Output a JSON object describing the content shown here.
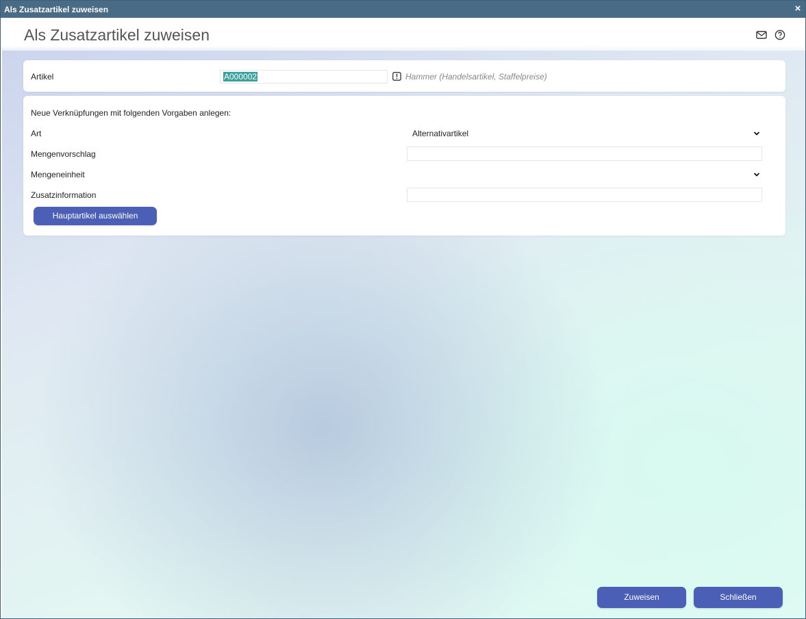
{
  "window": {
    "title": "Als Zusatzartikel zuweisen",
    "close_label": "×"
  },
  "header": {
    "title": "Als Zusatzartikel zuweisen",
    "icons": [
      "mail-icon",
      "help-icon"
    ]
  },
  "artikel": {
    "label": "Artikel",
    "value": "A000002",
    "description": "Hammer (Handelsartikel, Staffelpreise)",
    "icon": "warning-icon"
  },
  "vorgaben": {
    "heading": "Neue Verknüpfungen mit folgenden Vorgaben anlegen:",
    "art": {
      "label": "Art",
      "value": "Alternativartikel"
    },
    "mengenvorschlag": {
      "label": "Mengenvorschlag",
      "value": ""
    },
    "mengeneinheit": {
      "label": "Mengeneinheit",
      "value": ""
    },
    "zusatzinformation": {
      "label": "Zusatzinformation",
      "value": ""
    },
    "haupt_button": "Hauptartikel auswählen"
  },
  "footer": {
    "zuweisen": "Zuweisen",
    "schliessen": "Schließen"
  },
  "colors": {
    "titlebar": "#4a6b85",
    "button": "#4a5fb5",
    "selection": "#3aa0a0"
  }
}
